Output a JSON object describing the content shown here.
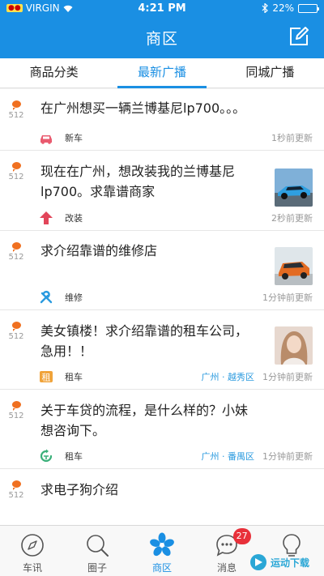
{
  "status_bar": {
    "carrier": "VIRGIN",
    "carrier_badge": "●●",
    "time": "4:21 PM",
    "battery": "22%",
    "battery_level": 0.22
  },
  "header": {
    "title": "商区"
  },
  "tabs": [
    {
      "label": "商品分类"
    },
    {
      "label": "最新广播",
      "active": true
    },
    {
      "label": "同城广播"
    }
  ],
  "posts": [
    {
      "text_line1": "在广州想买一辆兰博基尼lp700。。。",
      "text_line2": "",
      "count": "512",
      "tag": "新车",
      "tag_icon": "car-icon",
      "location": "",
      "time": "1秒前更新"
    },
    {
      "text_line1": "现在在广州，想改装我的兰博基尼",
      "text_line2": "lp700。求靠谱商家",
      "count": "512",
      "tag": "改装",
      "tag_icon": "upgrade-arrow-icon",
      "location": "",
      "time": "2秒前更新"
    },
    {
      "text_line1": "求介绍靠谱的维修店",
      "text_line2": "",
      "count": "512",
      "tag": "维修",
      "tag_icon": "wrench-icon",
      "location": "",
      "time": "1分钟前更新"
    },
    {
      "text_line1": "美女镇楼！求介绍靠谱的租车公司，",
      "text_line2": "急用！！",
      "count": "512",
      "tag": "租车",
      "tag_icon": "rent-icon",
      "location": "广州 · 越秀区",
      "time": "1分钟前更新"
    },
    {
      "text_line1": "关于车贷的流程，是什么样的？小妹",
      "text_line2": "想咨询下。",
      "count": "512",
      "tag": "租车",
      "tag_icon": "loan-icon",
      "location": "广州 · 番禺区",
      "time": "1分钟前更新"
    },
    {
      "text_line1": "求电子狗介绍",
      "text_line2": "",
      "count": "512",
      "tag": "",
      "tag_icon": "",
      "location": "",
      "time": ""
    }
  ],
  "tabbar": [
    {
      "label": "车讯",
      "icon": "compass-icon"
    },
    {
      "label": "圈子",
      "icon": "magnifier-icon"
    },
    {
      "label": "商区",
      "icon": "flower-icon",
      "active": true
    },
    {
      "label": "消息",
      "icon": "chat-bubble-icon",
      "badge": "27"
    },
    {
      "label": "",
      "icon": "lightbulb-icon"
    }
  ],
  "watermark": {
    "text": "运动下载"
  },
  "colors": {
    "primary": "#1a8fe3",
    "accent_orange": "#f07020",
    "badge_red": "#e8303a",
    "location_blue": "#2a9adf"
  }
}
